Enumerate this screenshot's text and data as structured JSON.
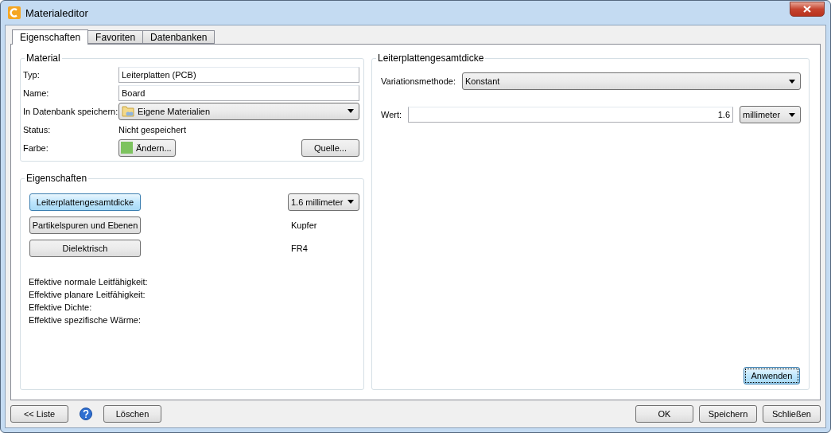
{
  "window": {
    "title": "Materialeditor"
  },
  "tabs": [
    {
      "label": "Eigenschaften",
      "selected": true
    },
    {
      "label": "Favoriten",
      "selected": false
    },
    {
      "label": "Datenbanken",
      "selected": false
    }
  ],
  "material": {
    "title": "Material",
    "type_label": "Typ:",
    "type_value": "Leiterplatten (PCB)",
    "name_label": "Name:",
    "name_value": "Board",
    "db_label": "In Datenbank speichern:",
    "db_value": "Eigene Materialien",
    "status_label": "Status:",
    "status_value": "Nicht gespeichert",
    "color_label": "Farbe:",
    "color": "#7dc35f",
    "color_button": "Ändern...",
    "source_button": "Quelle..."
  },
  "properties": {
    "title": "Eigenschaften",
    "items": [
      {
        "label": "Leiterplattengesamtdicke",
        "selected": true,
        "kind": "dropdown",
        "value": "1.6 millimeter"
      },
      {
        "label": "Partikelspuren und Ebenen",
        "selected": false,
        "kind": "text",
        "value": "Kupfer"
      },
      {
        "label": "Dielektrisch",
        "selected": false,
        "kind": "text",
        "value": "FR4"
      }
    ],
    "effective": [
      "Effektive normale Leitfähigkeit:",
      "Effektive planare Leitfähigkeit:",
      "Effektive Dichte:",
      "Effektive spezifische Wärme:"
    ]
  },
  "detail": {
    "title": "Leiterplattengesamtdicke",
    "method_label": "Variationsmethode:",
    "method_value": "Konstant",
    "value_label": "Wert:",
    "value": "1.6",
    "unit": "millimeter",
    "apply_button": "Anwenden"
  },
  "footer": {
    "left_buttons": [
      "<< Liste",
      "Löschen"
    ],
    "right_buttons": [
      "OK",
      "Speichern",
      "Schließen"
    ]
  }
}
